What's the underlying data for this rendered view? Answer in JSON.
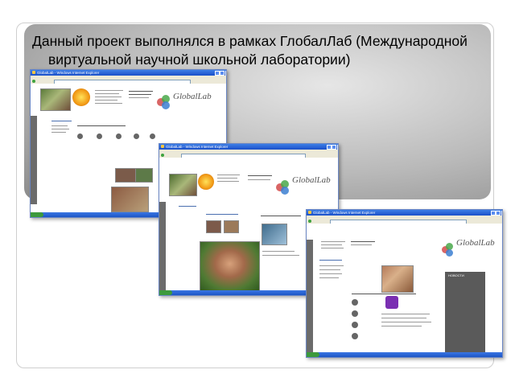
{
  "slide": {
    "title_line1": "Данный проект выполнялся в рамках ГлобалЛаб (Международной",
    "title_line2": "виртуальной научной школьной лаборатории)"
  },
  "screenshots": [
    {
      "name": "screenshot-1",
      "window_title": "GlobalLab - Windows Internet Explorer",
      "logo": "GlobalLab"
    },
    {
      "name": "screenshot-2",
      "window_title": "GlobalLab - Windows Internet Explorer",
      "logo": "GlobalLab"
    },
    {
      "name": "screenshot-3",
      "window_title": "GlobalLab - Windows Internet Explorer",
      "logo": "GlobalLab",
      "news_label": "НОВОСТИ"
    }
  ],
  "colors": {
    "panel_gray": "#b9b9b9",
    "xp_titlebar": "#1a4fc9",
    "xp_chrome": "#ece9d8",
    "logo_blue": "#3b7fd1",
    "logo_green": "#49a84a",
    "logo_red": "#d24a4a"
  }
}
